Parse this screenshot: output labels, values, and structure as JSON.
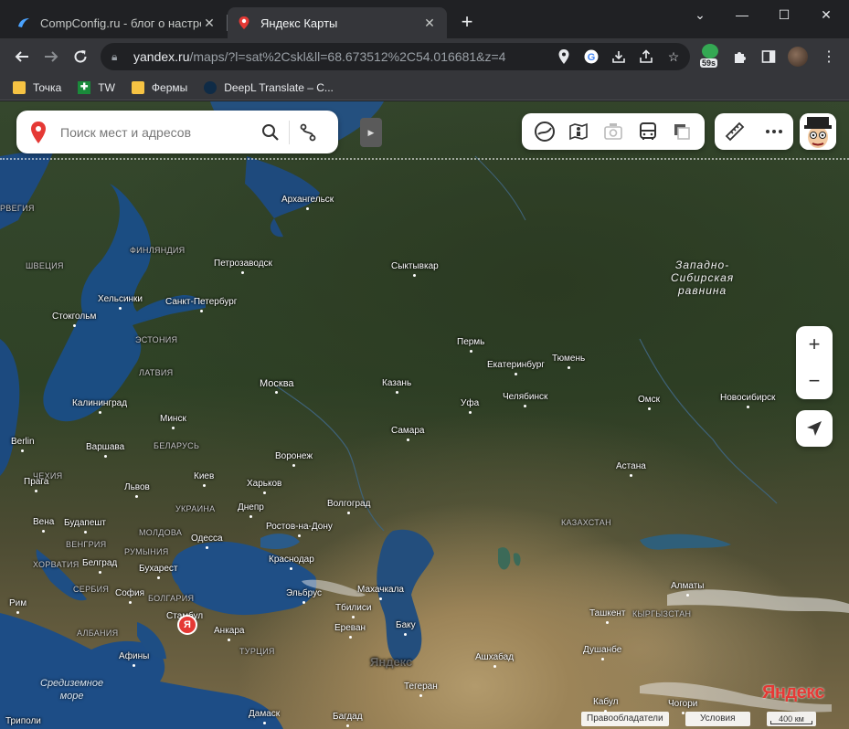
{
  "tabs": [
    {
      "title": "CompConfig.ru - блог о настрой",
      "active": false
    },
    {
      "title": "Яндекс Карты",
      "active": true
    }
  ],
  "address": {
    "host": "yandex.ru",
    "path": "/maps/?l=sat%2Cskl&ll=68.673512%2C54.016681&z=4"
  },
  "extension_badge": "59s",
  "bookmarks": [
    "Точка",
    "TW",
    "Фермы",
    "DeepL Translate – C..."
  ],
  "map": {
    "search_placeholder": "Поиск мест и адресов",
    "region": "Западно-\nСибирская\nравнина",
    "region_lines": [
      "Западно-",
      "Сибирская",
      "равнина"
    ],
    "sea_mediterranean": [
      "Средиземное",
      "море"
    ],
    "cities": {
      "arkhangelsk": "Архангельск",
      "petrozavodsk": "Петрозаводск",
      "syktyvkar": "Сыктывкар",
      "helsinki": "Хельсинки",
      "spb": "Санкт-Петербург",
      "stockholm": "Стокгольм",
      "perm": "Пермь",
      "yekaterinburg": "Екатеринбург",
      "tyumen": "Тюмень",
      "moscow": "Москва",
      "kazan": "Казань",
      "ufa": "Уфа",
      "chelyabinsk": "Челябинск",
      "omsk": "Омск",
      "novosibirsk": "Новосибирск",
      "kaliningrad": "Калининград",
      "minsk": "Минск",
      "samara": "Самара",
      "berlin": "Berlin",
      "warsaw": "Варшава",
      "voronezh": "Воронеж",
      "astana": "Астана",
      "prague": "Прага",
      "lviv": "Львов",
      "kyiv": "Киев",
      "kharkiv": "Харьков",
      "volgograd": "Волгоград",
      "dnipro": "Днепр",
      "vienna": "Вена",
      "budapest": "Будапешт",
      "odesa": "Одесса",
      "rostov": "Ростов-на-Дону",
      "belgrade": "Белград",
      "bucharest": "Бухарест",
      "krasnodar": "Краснодар",
      "rome": "Рим",
      "sofia": "София",
      "elbrus": "Эльбрус",
      "makhachkala": "Махачкала",
      "tbilisi": "Тбилиси",
      "almaty": "Алматы",
      "istanbul": "Стамбул",
      "ankara": "Анкара",
      "yerevan": "Ереван",
      "baku": "Баку",
      "tashkent": "Ташкент",
      "athens": "Афины",
      "ashgabat": "Ашхабад",
      "dushanbe": "Душанбе",
      "tehran": "Тегеран",
      "tripoli": "Триполи",
      "damascus": "Дамаск",
      "baghdad": "Багдад",
      "kabul": "Кабул",
      "chogori": "Чогори"
    },
    "countries": {
      "norway": "РВЕГИЯ",
      "finland": "ФИНЛЯНДИЯ",
      "sweden": "ШВЕЦИЯ",
      "estonia": "ЭСТОНИЯ",
      "latvia": "ЛАТВИЯ",
      "belarus": "БЕЛАРУСЬ",
      "czech": "ЧЕХИЯ",
      "ukraine": "УКРАИНА",
      "moldova": "МОЛДОВА",
      "hungary": "ВЕНГРИЯ",
      "romania": "РУМЫНИЯ",
      "croatia": "ХОРВАТИЯ",
      "serbia": "СЕРБИЯ",
      "bulgaria": "БОЛГАРИЯ",
      "albania": "АЛБАНИЯ",
      "kazakhstan": "КАЗАХСТАН",
      "kyrgyzstan": "КЫРГЫЗСТАН",
      "turkey": "ТУРЦИЯ"
    },
    "watermark": "Яндекс",
    "logo": "Яндекс",
    "copyright": "Правообладатели",
    "terms": "Условия",
    "scale": "400 км"
  },
  "colors": {
    "accent": "#e53935",
    "chrome_bg": "#202124",
    "toolbar_bg": "#35363a",
    "water": "#1d4a80"
  }
}
